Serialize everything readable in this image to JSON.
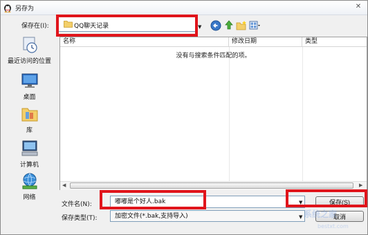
{
  "window": {
    "title": "另存为",
    "close_glyph": "✕"
  },
  "toolbar": {
    "save_in_label": "保存在(I):",
    "location_value": "QQ聊天记录",
    "dropdown_glyph": "▼",
    "icons": [
      "back-icon",
      "up-folder-icon",
      "new-folder-icon",
      "view-menu-icon"
    ]
  },
  "places": [
    {
      "label": "最近访问的位置",
      "icon": "recent-places-icon"
    },
    {
      "label": "桌面",
      "icon": "desktop-icon"
    },
    {
      "label": "库",
      "icon": "libraries-icon"
    },
    {
      "label": "计算机",
      "icon": "computer-icon"
    },
    {
      "label": "网络",
      "icon": "network-icon"
    }
  ],
  "file_list": {
    "columns": [
      "名称",
      "修改日期",
      "类型"
    ],
    "empty_message": "没有与搜索条件匹配的项。"
  },
  "filename": {
    "label": "文件名(N):",
    "value": "嘟嘟是个好人.bak"
  },
  "filetype": {
    "label": "保存类型(T):",
    "value": "加密文件(*.bak,支持导入)"
  },
  "buttons": {
    "save": "保存(S)",
    "cancel": "取消"
  },
  "watermark": {
    "brand": "系统之家",
    "site": "bestxt.com"
  },
  "colors": {
    "highlight_frame": "#e0141b",
    "field_border": "#7f9db9"
  }
}
